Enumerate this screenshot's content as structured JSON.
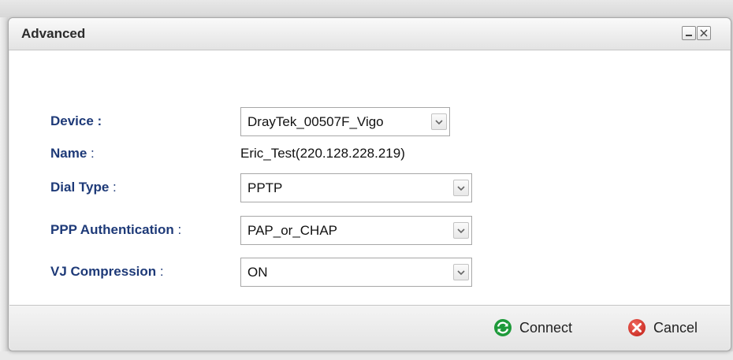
{
  "dialog": {
    "title": "Advanced"
  },
  "form": {
    "device": {
      "label": "Device :",
      "value": "DrayTek_00507F_Vigo"
    },
    "name": {
      "label": "Name",
      "colon": " :",
      "value": "Eric_Test(220.128.228.219)"
    },
    "dial_type": {
      "label": "Dial Type",
      "colon": " :",
      "value": "PPTP"
    },
    "ppp_auth": {
      "label": "PPP Authentication",
      "colon": " :",
      "value": "PAP_or_CHAP"
    },
    "vj_compression": {
      "label": "VJ Compression",
      "colon": " :",
      "value": "ON"
    }
  },
  "footer": {
    "connect_label": "Connect",
    "cancel_label": "Cancel"
  },
  "icons": {
    "minimize": "minimize-icon",
    "close": "close-icon",
    "dropdown": "chevron-down-icon",
    "connect": "refresh-icon",
    "cancel": "cancel-icon"
  },
  "colors": {
    "label": "#1e3a78",
    "connect_icon": "#1e9a3a",
    "cancel_icon": "#d9342b"
  }
}
